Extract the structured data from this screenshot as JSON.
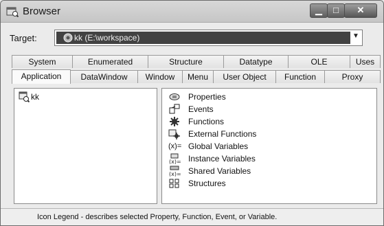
{
  "window": {
    "title": "Browser"
  },
  "target": {
    "label": "Target:",
    "value": "kk (E:\\workspace)"
  },
  "tabs": {
    "row1": [
      "System",
      "Enumerated",
      "Structure",
      "Datatype",
      "OLE",
      "Uses"
    ],
    "row2": [
      "Application",
      "DataWindow",
      "Window",
      "Menu",
      "User Object",
      "Function",
      "Proxy"
    ]
  },
  "tree": {
    "items": [
      {
        "label": "kk",
        "icon": "application-icon"
      }
    ]
  },
  "legend": {
    "items": [
      {
        "label": "Properties",
        "icon": "properties-icon"
      },
      {
        "label": "Events",
        "icon": "events-icon"
      },
      {
        "label": "Functions",
        "icon": "functions-icon"
      },
      {
        "label": "External Functions",
        "icon": "external-functions-icon"
      },
      {
        "label": "Global Variables",
        "icon": "global-variables-icon"
      },
      {
        "label": "Instance Variables",
        "icon": "instance-variables-icon"
      },
      {
        "label": "Shared Variables",
        "icon": "shared-variables-icon"
      },
      {
        "label": "Structures",
        "icon": "structures-icon"
      }
    ]
  },
  "status": {
    "text": "Icon Legend - describes selected Property, Function, Event, or Variable."
  }
}
